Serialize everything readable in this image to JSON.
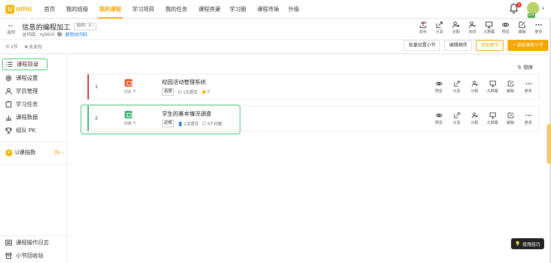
{
  "nav": {
    "logo_mark": "U",
    "logo_text": "umu",
    "items": [
      {
        "label": "首页"
      },
      {
        "label": "我的班级"
      },
      {
        "label": "我的课程",
        "active": true
      },
      {
        "label": "学习项目"
      },
      {
        "label": "我的任务"
      },
      {
        "label": "课程资源"
      },
      {
        "label": "学习圈"
      },
      {
        "label": "课程市场"
      },
      {
        "label": "升级"
      }
    ],
    "notification_count": "1",
    "level_badge": "LV4"
  },
  "course": {
    "back_label": "返回",
    "title": "信息的编程加工",
    "collab_label": "协同：0",
    "access_code_label": "访问码：hy5610",
    "copy_code_label": "复制访问码",
    "actions": [
      {
        "label": "发布",
        "icon": "publish-icon"
      },
      {
        "label": "分享",
        "icon": "share-icon"
      },
      {
        "label": "分配",
        "icon": "assign-icon"
      },
      {
        "label": "协同",
        "icon": "collab-icon"
      },
      {
        "label": "大屏幕",
        "icon": "screen-icon"
      },
      {
        "label": "预览",
        "icon": "preview-icon"
      },
      {
        "label": "编辑",
        "icon": "edit-icon"
      },
      {
        "label": "更多",
        "icon": "more-icon"
      }
    ]
  },
  "toolbar": {
    "section_count": "2节",
    "status": "未发布",
    "batch_label": "批量设置小节",
    "order_label": "编辑顺序",
    "add_chapter_label": "添加章节",
    "add_section_label": "+ 添加课程小节"
  },
  "sidebar": {
    "items": [
      {
        "label": "课程目录",
        "icon": "list-icon"
      },
      {
        "label": "课程设置",
        "icon": "settings-icon"
      },
      {
        "label": "学员管理",
        "icon": "users-icon"
      },
      {
        "label": "学习任务",
        "icon": "task-icon"
      },
      {
        "label": "课程数据",
        "icon": "chart-icon"
      },
      {
        "label": "组队 PK",
        "icon": "trophy-icon"
      }
    ],
    "u_index_label": "U课指数",
    "u_index_value": "35",
    "bottom": [
      {
        "label": "课程操作日志",
        "icon": "log-icon"
      },
      {
        "label": "小节回收站",
        "icon": "trash-icon"
      }
    ]
  },
  "main": {
    "sort_label": "倒序",
    "sections": [
      {
        "num": "1",
        "type_label": "讨论",
        "type_color": "#e05a2b",
        "border_color": "#c9302c",
        "title": "校园活动管理系统",
        "tag": "选修",
        "submits": "1次提交",
        "likes": "0"
      },
      {
        "num": "2",
        "type_label": "问卷",
        "type_color": "#3cb371",
        "border_color": "#3cb371",
        "title": "学生的基本情况调查",
        "tag": "必修",
        "submits": "1次提交",
        "questions": "5个问题"
      }
    ],
    "row_actions": [
      {
        "label": "预览"
      },
      {
        "label": "分享"
      },
      {
        "label": "分配"
      },
      {
        "label": "大屏幕"
      },
      {
        "label": "编辑"
      },
      {
        "label": "更多"
      }
    ]
  },
  "tips_label": "使用技巧"
}
